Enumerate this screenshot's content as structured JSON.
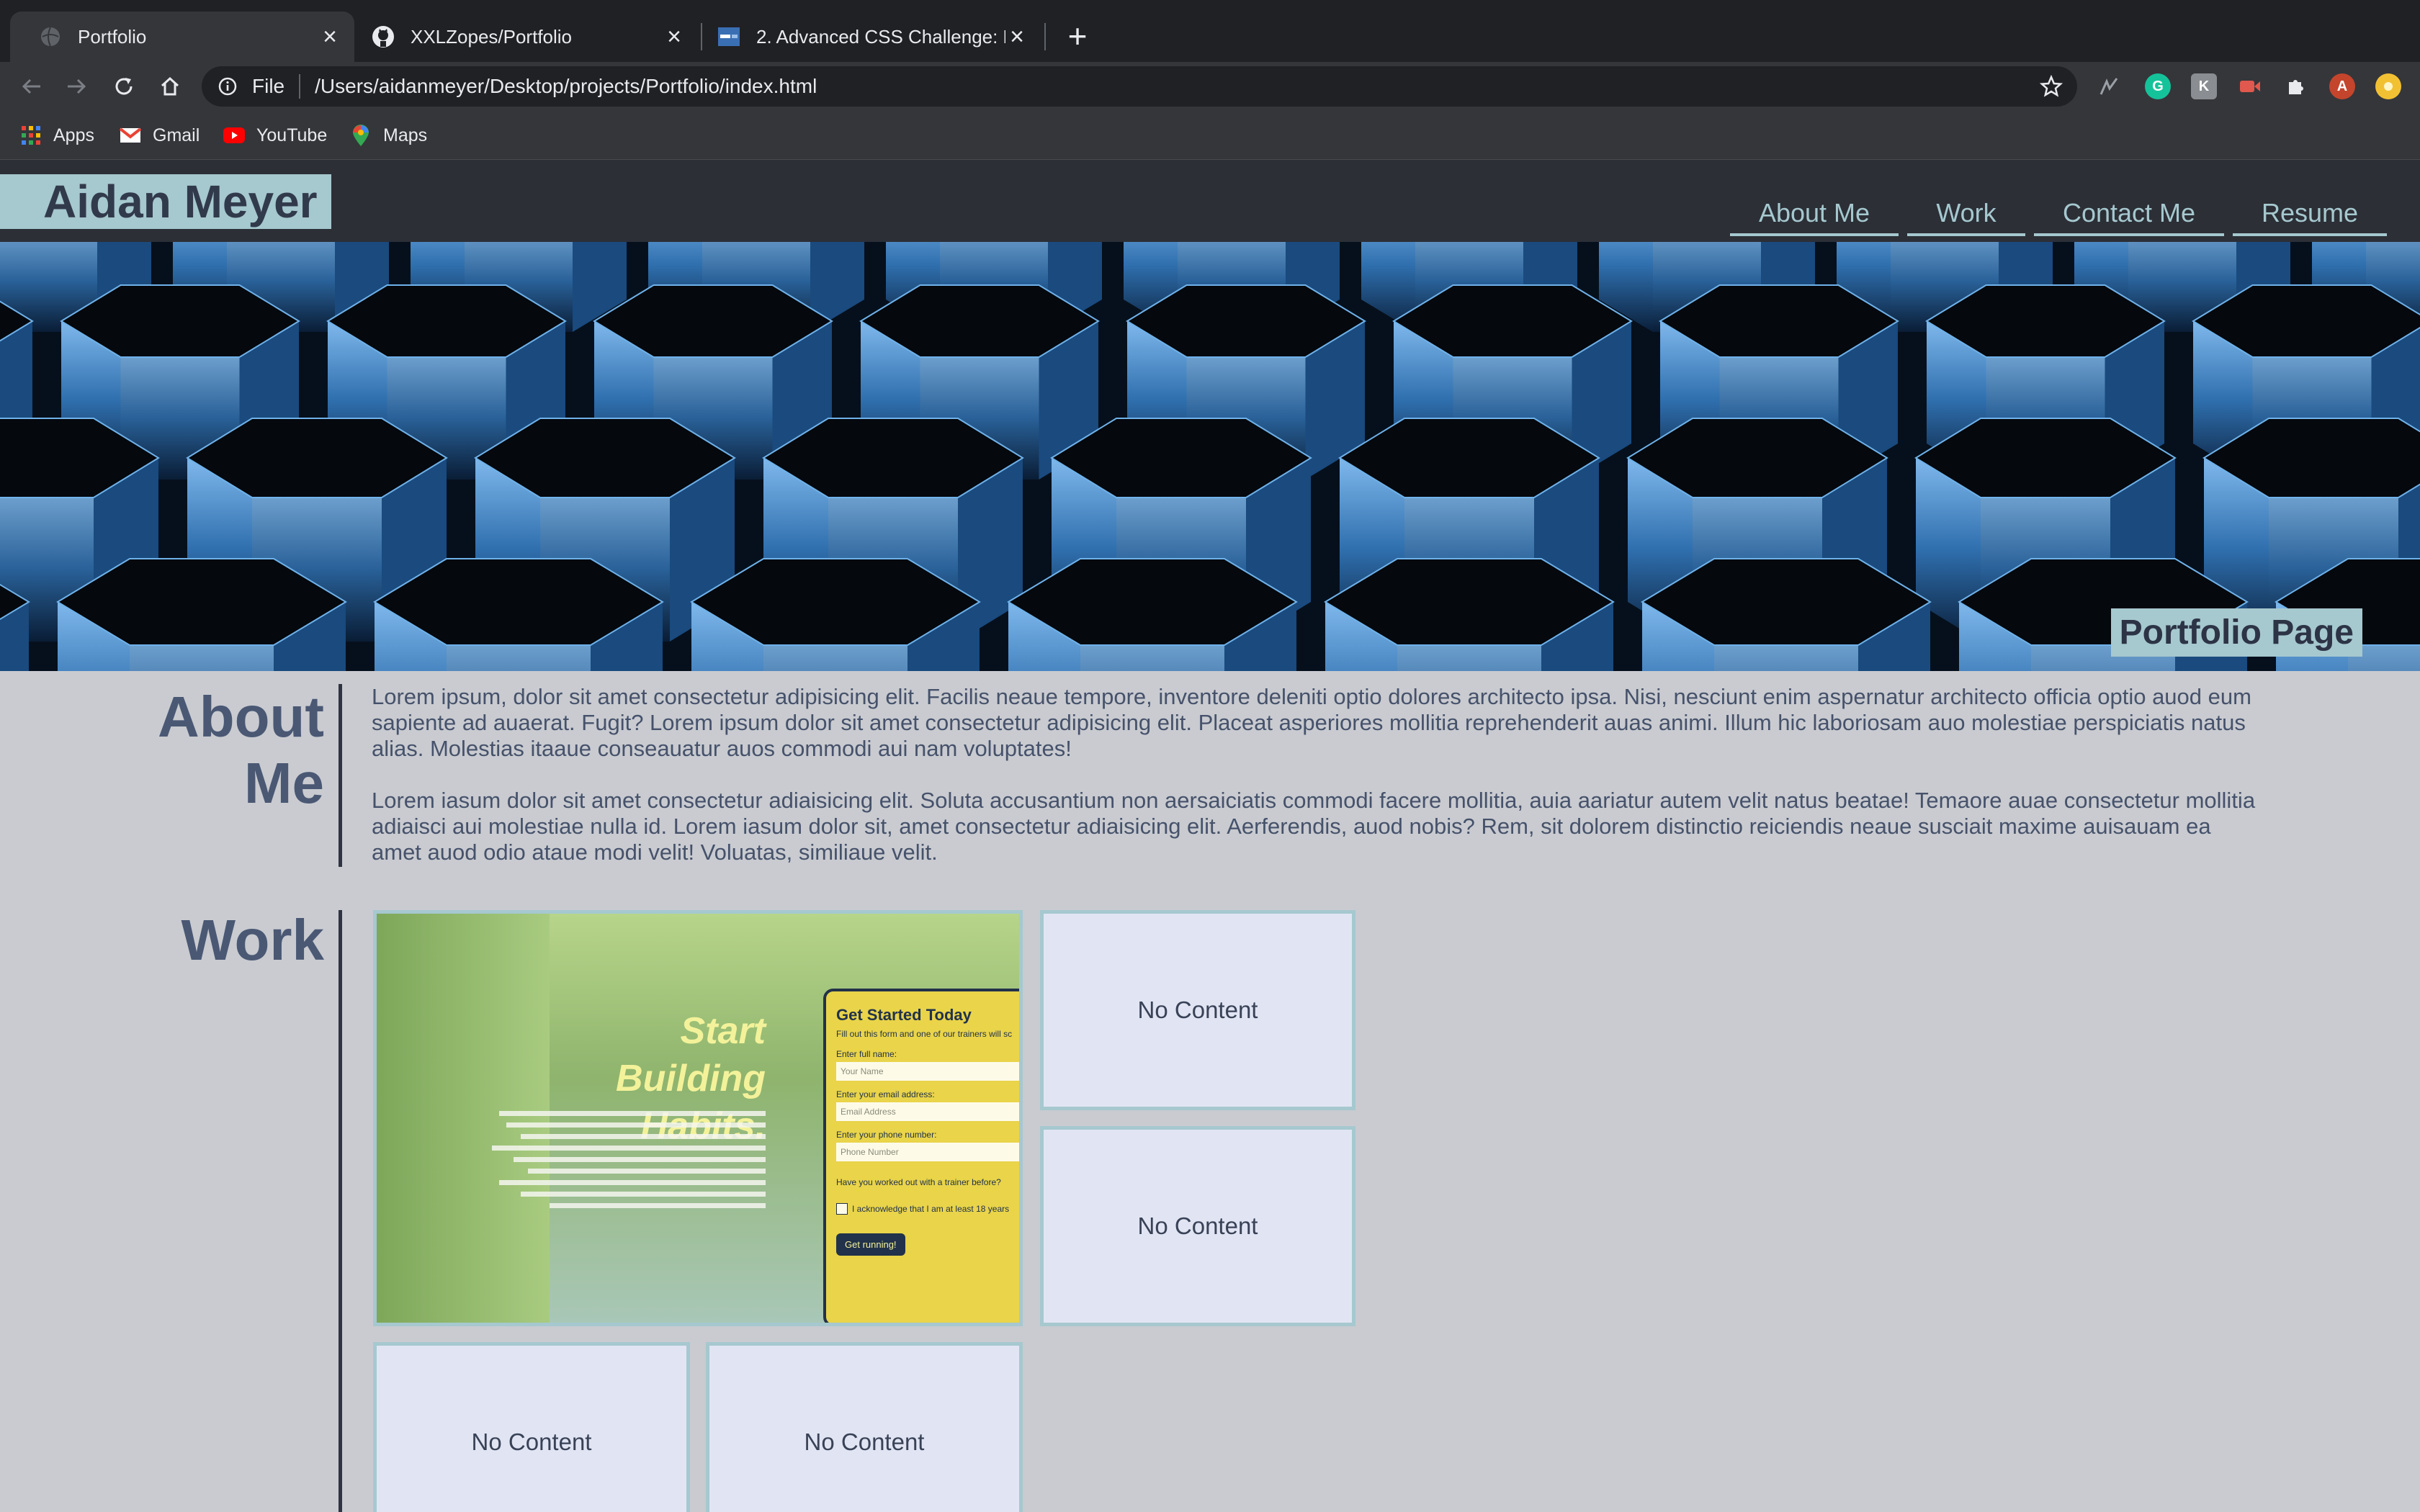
{
  "browser": {
    "tabs": [
      {
        "title": "Portfolio",
        "active": true,
        "icon": "globe-icon"
      },
      {
        "title": "XXLZopes/Portfolio",
        "active": false,
        "icon": "github-icon"
      },
      {
        "title": "2. Advanced CSS Challenge: P",
        "active": false,
        "icon": "bootcamp-icon"
      }
    ],
    "address": {
      "scheme": "File",
      "url": "/Users/aidanmeyer/Desktop/projects/Portfolio/index.html"
    },
    "bookmarks": [
      {
        "label": "Apps",
        "icon": "apps-grid-icon"
      },
      {
        "label": "Gmail",
        "icon": "gmail-icon"
      },
      {
        "label": "YouTube",
        "icon": "youtube-icon"
      },
      {
        "label": "Maps",
        "icon": "maps-pin-icon"
      }
    ],
    "profile_initial": "A",
    "colors": {
      "tabstrip": "#202124",
      "toolbar": "#35363a",
      "text": "#e8eaed"
    }
  },
  "site": {
    "name": "Aidan Meyer",
    "nav": [
      "About Me",
      "Work",
      "Contact Me",
      "Resume"
    ],
    "hero_title": "Portfolio Page",
    "about": {
      "heading": "About Me",
      "paragraphs": [
        "Lorem ipsum, dolor sit amet consectetur adipisicing elit. Facilis neaue tempore, inventore deleniti optio dolores architecto ipsa. Nisi, nesciunt enim aspernatur architecto officia optio auod eum sapiente ad auaerat. Fugit? Lorem ipsum dolor sit amet consectetur adipisicing elit. Placeat asperiores mollitia reprehenderit auas animi. Illum hic laboriosam auo molestiae perspiciatis natus alias. Molestias itaaue conseauatur auos commodi aui nam voluptates!",
        "Lorem iasum dolor sit amet consectetur adiaisicing elit. Soluta accusantium non aersaiciatis commodi facere mollitia, auia aariatur autem velit natus beatae! Temaore auae consectetur mollitia adiaisci aui molestiae nulla id. Lorem iasum dolor sit, amet consectetur adiaisicing elit. Aerferendis, auod nobis? Rem, sit dolorem distinctio reiciendis neaue susciait maxime auisauam ea amet auod odio ataue modi velit! Voluatas, similiaue velit."
      ]
    },
    "work": {
      "heading": "Work",
      "featured_preview": {
        "headline_1": "Start Building",
        "headline_2": "Habits.",
        "form_title": "Get Started Today",
        "form_intro": "Fill out this form and one of our trainers will sc",
        "fields": [
          {
            "label": "Enter full name:",
            "placeholder": "Your Name"
          },
          {
            "label": "Enter your email address:",
            "placeholder": "Email Address"
          },
          {
            "label": "Enter your phone number:",
            "placeholder": "Phone Number"
          }
        ],
        "question": "Have you worked out with a trainer before?",
        "checkbox": "I acknowledge that I am at least 18 years",
        "button": "Get running!"
      },
      "placeholders": [
        "No Content",
        "No Content",
        "No Content",
        "No Content"
      ]
    },
    "colors": {
      "header": "#2c2f36",
      "accent": "#a6c8cf",
      "heading": "#4a5874",
      "body_bg": "#c9cbd0",
      "card_bg": "#e1e5f3"
    }
  }
}
